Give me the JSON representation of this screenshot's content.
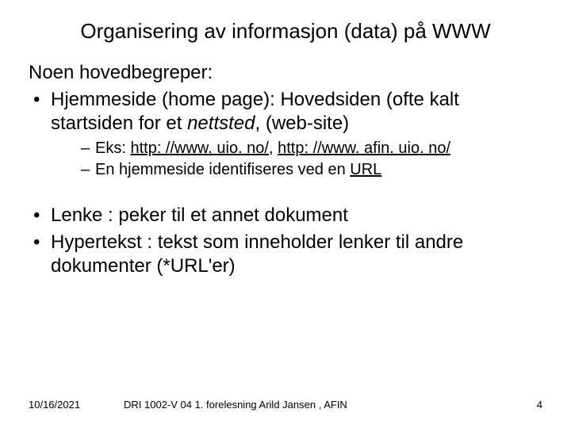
{
  "title": "Organisering av informasjon (data) på WWW",
  "lead": "Noen hovedbegreper:",
  "b1a": "Hjemmeside (home page): Hovedsiden (ofte kalt startsiden for et ",
  "b1_em": "nettsted",
  "b1b": ", (web-site)",
  "s1a": "Eks: ",
  "s1_link1": "http: //www. uio. no/",
  "s1_mid": ", ",
  "s1_link2": "http: //www. afin. uio. no/",
  "s2a": "En hjemmeside identifiseres ved en ",
  "s2_u": "URL",
  "b2": "Lenke : peker til et annet dokument",
  "b3": "Hypertekst : tekst som inneholder lenker til andre dokumenter (*URL'er)",
  "footer": {
    "date": "10/16/2021",
    "mid": "DRI 1002-V 04  1. forelesning    Arild Jansen , AFIN",
    "page": "4"
  }
}
